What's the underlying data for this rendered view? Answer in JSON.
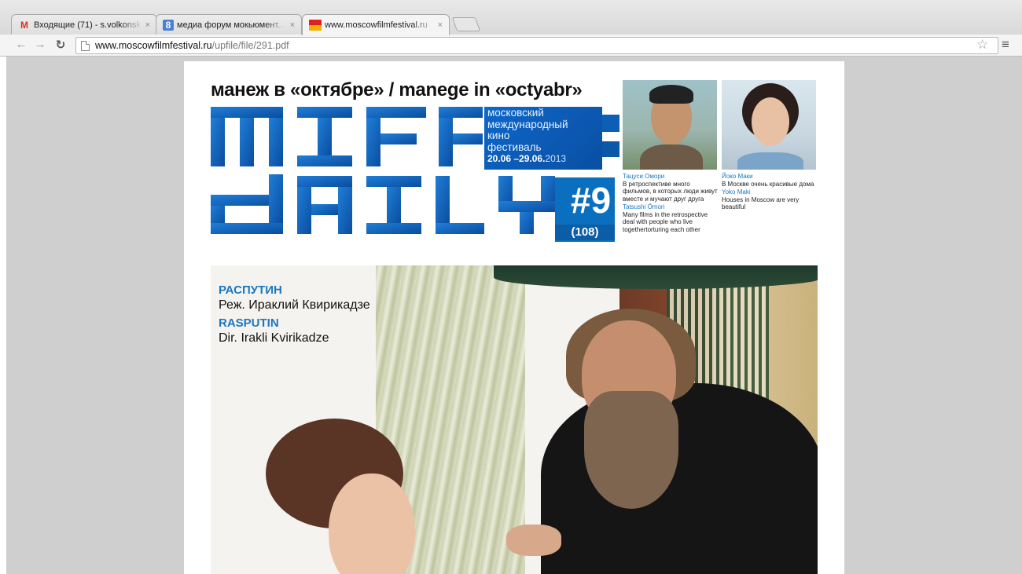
{
  "browser": {
    "tabs": [
      {
        "icon": "gmail-icon",
        "title": "Входящие (71) - s.volkonsk",
        "close": "×",
        "active": false
      },
      {
        "icon": "google-plus-icon",
        "title": "медиа форум мокьюмент...",
        "close": "×",
        "active": false
      },
      {
        "icon": "miff-favicon",
        "title": "www.moscowfilmfestival.ru",
        "close": "×",
        "active": true
      }
    ],
    "url_host": "www.moscowfilmfestival.ru",
    "url_path": "/upfile/file/291.pdf"
  },
  "pdf": {
    "headline": "манеж в «октябре» / manege in «octyabr»",
    "fest_box": {
      "line1": "московский",
      "line2": "международный",
      "line3": "кино",
      "line4": "фестиваль",
      "dates": "20.06 –29.06.",
      "year": "2013"
    },
    "issue": {
      "number": "#9",
      "sub": "(108)"
    },
    "portraits": [
      {
        "name_ru": "Тацуси Омори",
        "text_ru": "В ретроспективе много фильмов, в которых люди живут вместе и мучают друг друга",
        "name_en": "Tatsushi Ōmori",
        "text_en": "Many films in the retrospective deal with people who live togethertorturing each other"
      },
      {
        "name_ru": "Йоко Маки",
        "text_ru": "В Москве очень красивые дома",
        "name_en": "Yoko Maki",
        "text_en": "Houses in Moscow are very beautiful"
      }
    ],
    "film": {
      "title_ru": "РАСПУТИН",
      "director_ru": "Реж. Ираклий Квирикадзе",
      "title_en": "RASPUTIN",
      "director_en": "Dir. Irakli Kvirikadze"
    }
  }
}
